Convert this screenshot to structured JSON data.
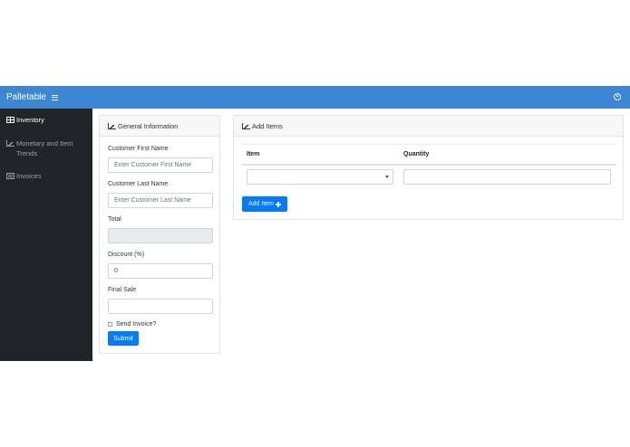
{
  "topbar": {
    "brand": "Palletable",
    "menu_icon": "hamburger-icon",
    "user_icon": "user-circle-icon",
    "color": "#3b87d6"
  },
  "sidebar": {
    "items": [
      {
        "label": "Inventory",
        "icon": "table-icon",
        "active": true
      },
      {
        "label": "Monetary and Item Trends",
        "icon": "area-chart-icon",
        "active": false
      },
      {
        "label": "Invoices",
        "icon": "list-alt-icon",
        "active": false
      }
    ]
  },
  "general_info": {
    "title": "General Information",
    "first_name": {
      "label": "Customer First Name",
      "placeholder": "Enter Customer First Name",
      "value": ""
    },
    "last_name": {
      "label": "Customer Last Name",
      "placeholder": "Enter Customer Last Name",
      "value": ""
    },
    "total": {
      "label": "Total",
      "value": ""
    },
    "discount": {
      "label": "Discount (%)",
      "value": "0"
    },
    "final_sale": {
      "label": "Final Sale",
      "value": ""
    },
    "send_invoice": {
      "label": "Send Invoice?",
      "checked": false
    },
    "submit_label": "Submit"
  },
  "add_items": {
    "title": "Add Items",
    "columns": [
      "Item",
      "Quantity"
    ],
    "item_select": {
      "value": ""
    },
    "quantity": {
      "value": ""
    },
    "add_button_label": "Add Item"
  }
}
